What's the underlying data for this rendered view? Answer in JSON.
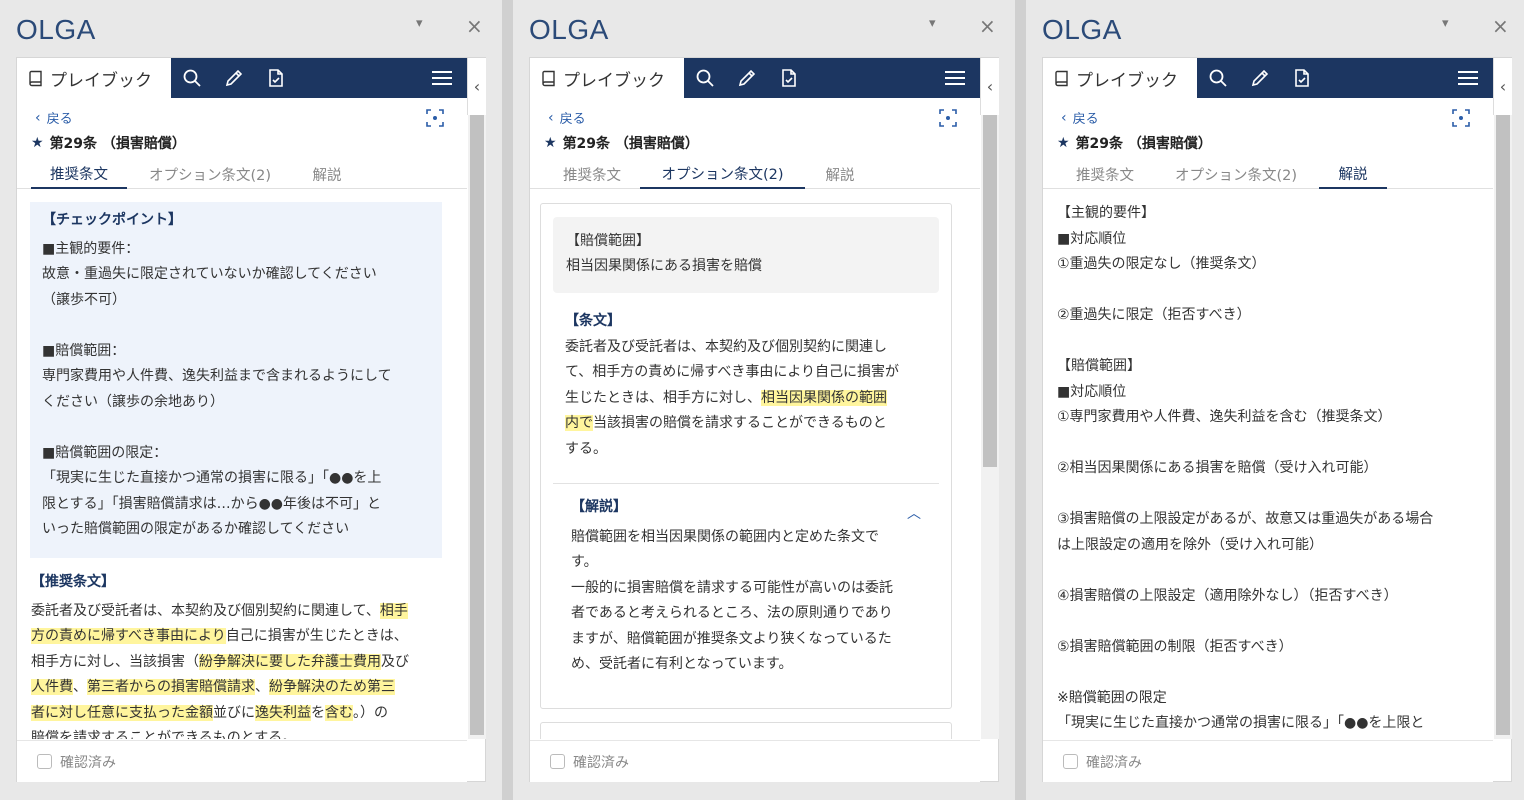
{
  "app": {
    "brand": "OLGA",
    "dropdown_icon": "▾",
    "close_icon": "×"
  },
  "nav": {
    "playbook_label": "プレイブック"
  },
  "article": {
    "back_label": "戻る",
    "title": "第29条 （損害賠償）"
  },
  "tabs": {
    "recommended": "推奨条文",
    "options": "オプション条文(2)",
    "explanation": "解説"
  },
  "footer": {
    "confirmed_label": "確認済み"
  },
  "panel1": {
    "checkpoint_title": "【チェックポイント】",
    "checkpoint_body": "■主観的要件：\n故意・重過失に限定されていないか確認してください\n（譲歩不可）\n\n■賠償範囲：\n専門家費用や人件費、逸失利益まで含まれるようにして\nください（譲歩の余地あり）\n\n■賠償範囲の限定：\n「現実に生じた直接かつ通常の損害に限る」「●●を上\n限とする」「損害賠償請求は…から●●年後は不可」と\nいった賠償範囲の限定があるか確認してください",
    "rec_title": "【推奨条文】",
    "rec_line1a": "委託者及び受託者は、本契約及び個別契約に関連して、",
    "rec_line1b": "相手",
    "rec_line2a": "方の責めに帰すべき事由により",
    "rec_line2b": "自己に損害が生じたときは、",
    "rec_line3a": "相手方に対し、当該損害（",
    "rec_line3b": "紛争解決に要した弁護士費用",
    "rec_line3c": "及び",
    "rec_line4a": "人件費",
    "rec_line4b": "、",
    "rec_line4c": "第三者からの損害賠償請求",
    "rec_line4d": "、",
    "rec_line4e": "紛争解決のため第三",
    "rec_line5a": "者に対し任意に支払った金額",
    "rec_line5b": "並びに",
    "rec_line5c": "逸失利益",
    "rec_line5d": "を",
    "rec_line5e": "含む",
    "rec_line5f": "。）の",
    "rec_line6": "賠償を請求することができるものとする。"
  },
  "panel2": {
    "grey_title": "【賠償範囲】",
    "grey_body": "相当因果関係にある損害を賠償",
    "clause_title": "【条文】",
    "clause_a": "委託者及び受託者は、本契約及び個別契約に関連し\nて、相手方の責めに帰すべき事由により自己に損害が\n生じたときは、相手方に対し、",
    "clause_hl1": "相当因果関係の範囲",
    "clause_hl2": "内で",
    "clause_b": "当該損害の賠償を請求することができるものと\nする。",
    "expl_title": "【解説】",
    "expl_body": "賠償範囲を相当因果関係の範囲内と定めた条文で\nす。\n一般的に損害賠償を請求する可能性が高いのは委託\n者であると考えられるところ、法の原則通りであり\nますが、賠償範囲が推奨条文より狭くなっているた\nめ、受託者に有利となっています。"
  },
  "panel3": {
    "body": "【主観的要件】\n■対応順位\n①重過失の限定なし（推奨条文）\n\n②重過失に限定（拒否すべき）\n\n【賠償範囲】\n■対応順位\n①専門家費用や人件費、逸失利益を含む（推奨条文）\n\n②相当因果関係にある損害を賠償（受け入れ可能）\n\n③損害賠償の上限設定があるが、故意又は重過失がある場合\nは上限設定の適用を除外（受け入れ可能）\n\n④損害賠償の上限設定（適用除外なし）（拒否すべき）\n\n⑤損害賠償範囲の制限（拒否すべき）\n\n※賠償範囲の限定\n「現実に生じた直接かつ通常の損害に限る」「●●を上限と"
  }
}
